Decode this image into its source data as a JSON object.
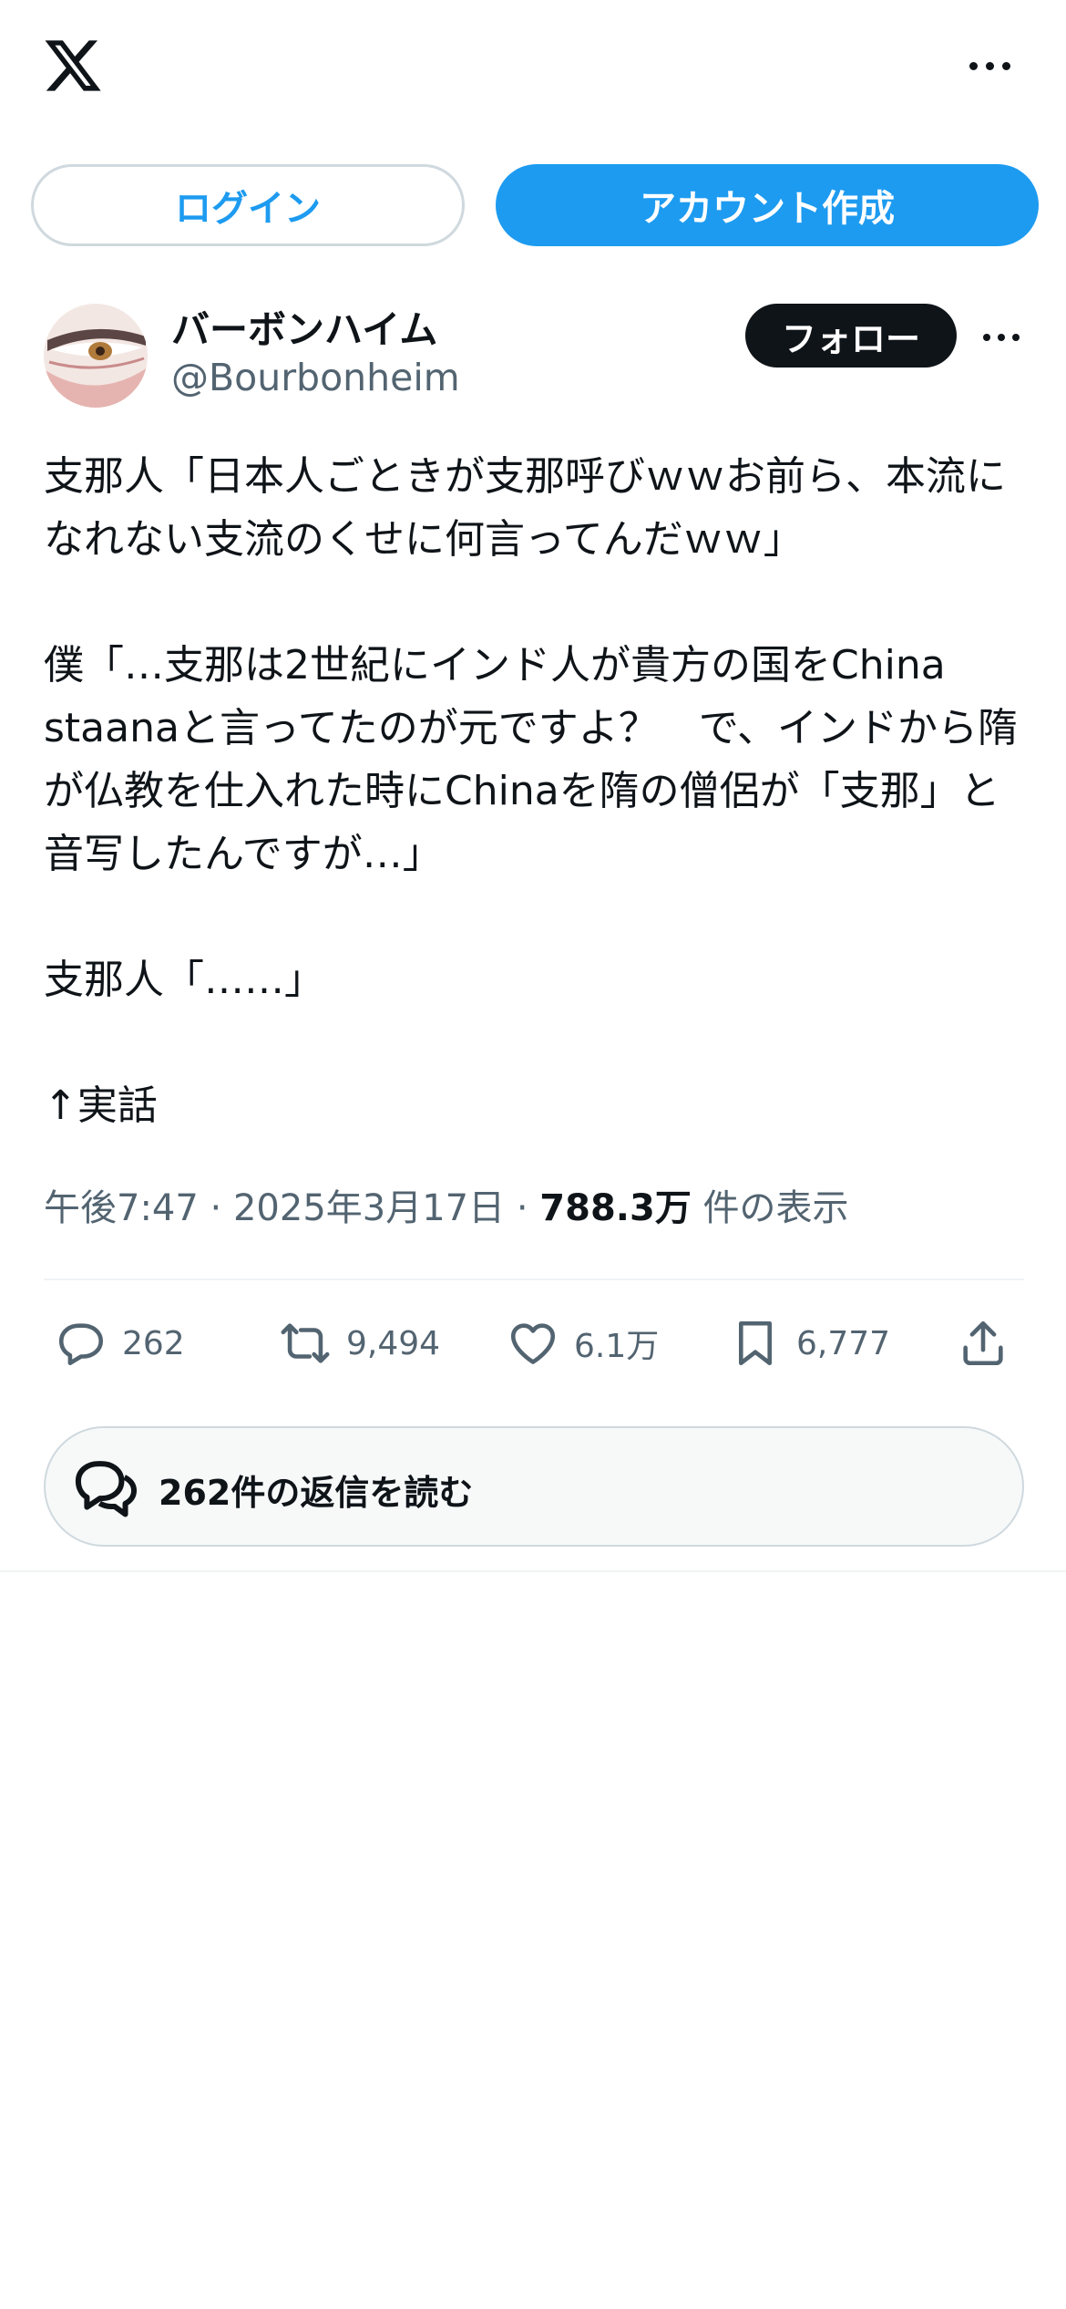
{
  "header": {
    "logo": "x-logo-icon",
    "menu_icon": "more-horizontal-icon"
  },
  "auth": {
    "login_label": "ログイン",
    "signup_label": "アカウント作成"
  },
  "tweet": {
    "author": {
      "display_name": "バーボンハイム",
      "handle": "@Bourbonheim",
      "follow_label": "フォロー"
    },
    "text": "支那人「日本人ごときが支那呼びｗｗお前ら、本流になれない支流のくせに何言ってんだｗｗ」\n\n僕「…支那は2世紀にインド人が貴方の国をChina staanaと言ってたのが元ですよ？　で、インドから隋が仏教を仕入れた時にChinaを隋の僧侶が「支那」と音写したんですが…」\n\n支那人「……」\n\n↑実話",
    "time": "午後7:47",
    "separator": "·",
    "date": "2025年3月17日",
    "views_count": "788.3万",
    "views_label": "件の表示",
    "stats": {
      "replies": "262",
      "retweets": "9,494",
      "likes": "6.1万",
      "bookmarks": "6,777"
    },
    "read_replies_label": "262件の返信を読む"
  },
  "colors": {
    "accent": "#1d9bf0",
    "text": "#0f1419",
    "secondary": "#536471",
    "border": "#cfd9de"
  }
}
